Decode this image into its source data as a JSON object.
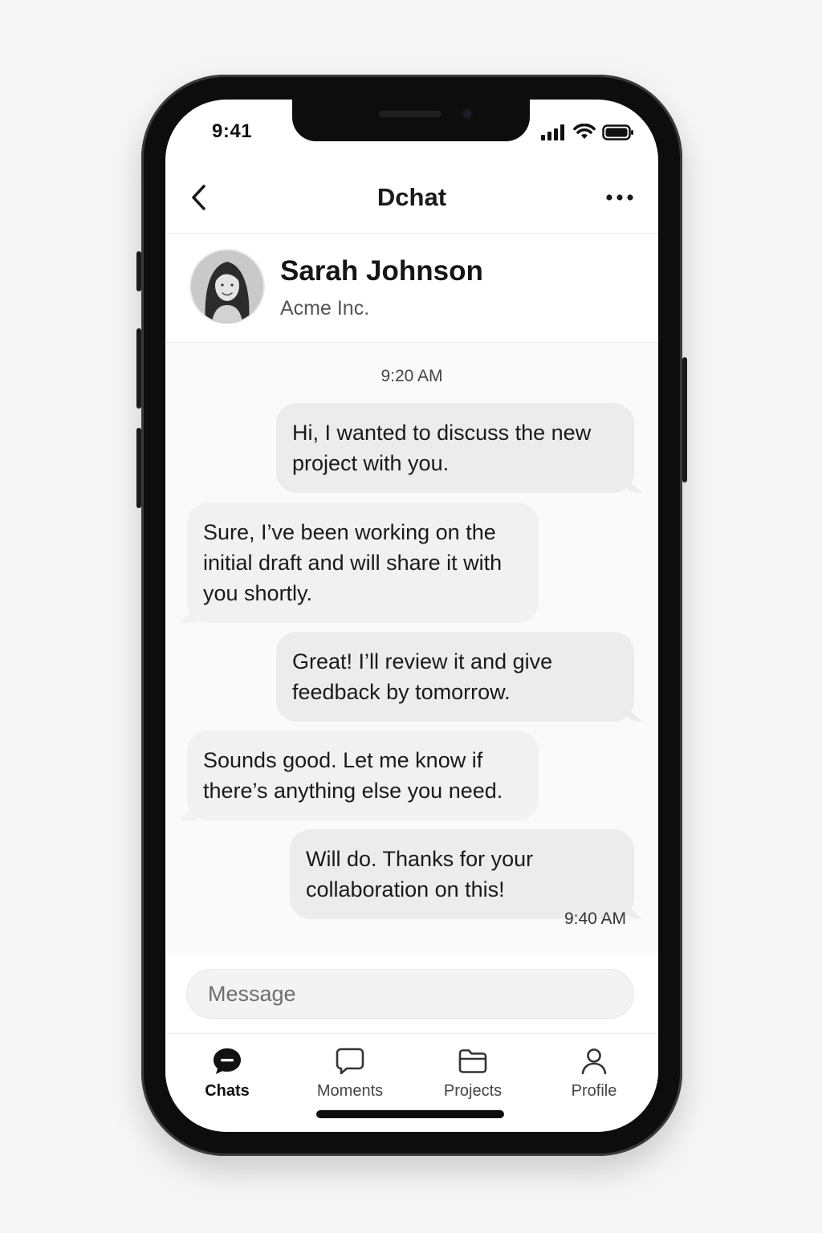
{
  "status_bar": {
    "time": "9:41",
    "icons": [
      "cellular-signal-icon",
      "wifi-icon",
      "battery-icon"
    ]
  },
  "nav": {
    "back_icon": "chevron-left-icon",
    "title": "Dchat",
    "more_icon": "ellipsis-icon"
  },
  "contact": {
    "name": "Sarah Johnson",
    "company": "Acme Inc."
  },
  "chat": {
    "time_separator": "9:20 AM",
    "messages": [
      {
        "direction": "outgoing",
        "text": "Hi, I wanted to discuss the new project with you."
      },
      {
        "direction": "incoming",
        "text": "Sure, I’ve been working on the initial draft and will share it with you shortly."
      },
      {
        "direction": "outgoing",
        "text": "Great! I’ll review it and give feedback by tomorrow."
      },
      {
        "direction": "incoming",
        "text": "Sounds good. Let me know if there’s anything else you need."
      },
      {
        "direction": "outgoing",
        "text": "Will do. Thanks for your collaboration on this!"
      }
    ],
    "last_message_time": "9:40 AM"
  },
  "composer": {
    "placeholder": "Message",
    "value": ""
  },
  "tabs": [
    {
      "label": "Chats",
      "icon": "chat-bubble-filled-icon",
      "active": true
    },
    {
      "label": "Moments",
      "icon": "chat-bubble-outline-icon",
      "active": false
    },
    {
      "label": "Projects",
      "icon": "folder-icon",
      "active": false
    },
    {
      "label": "Profile",
      "icon": "person-icon",
      "active": false
    }
  ],
  "colors": {
    "bubble_outgoing": "#ececec",
    "bubble_incoming": "#f1f1f1",
    "text_primary": "#1a1a1a",
    "text_secondary": "#555555",
    "device_frame": "#0d0d0d"
  }
}
